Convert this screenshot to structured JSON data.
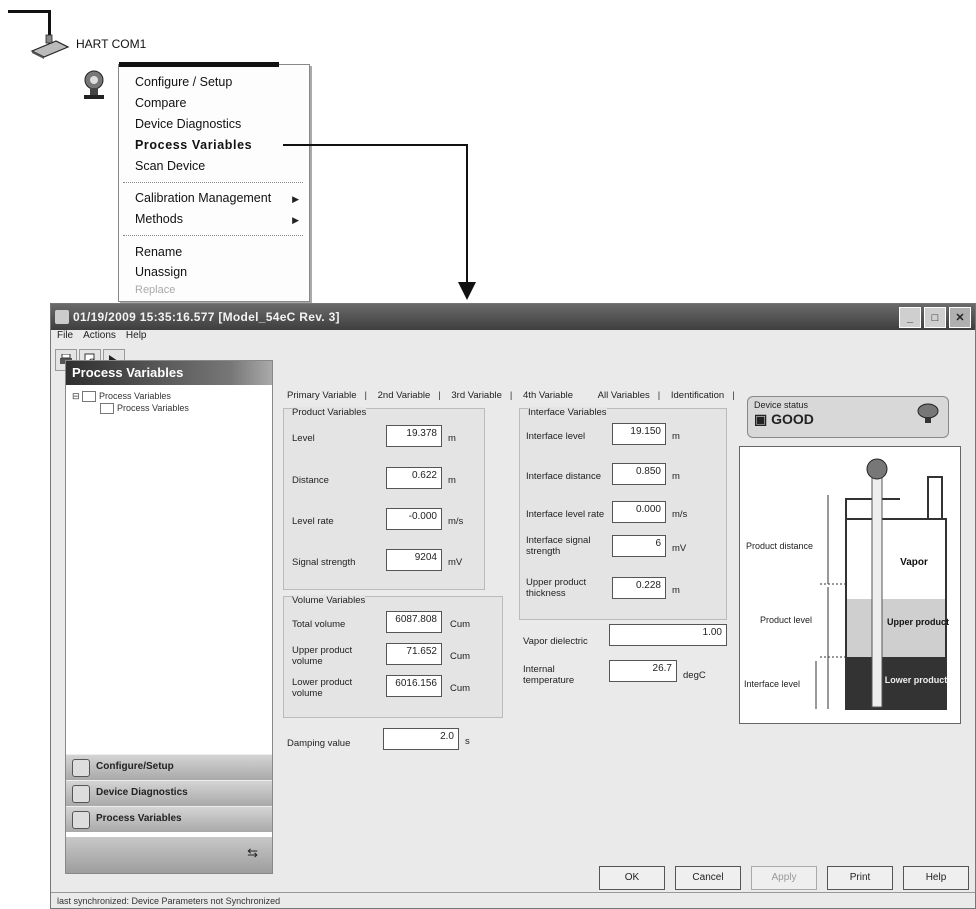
{
  "tree": {
    "hart_label": "HART COM1"
  },
  "context_menu": {
    "items": [
      {
        "label": "Configure / Setup"
      },
      {
        "label": "Compare"
      },
      {
        "label": "Device Diagnostics"
      },
      {
        "label": "Process Variables"
      },
      {
        "label": "Scan Device"
      },
      {
        "label": "Calibration Management"
      },
      {
        "label": "Methods"
      },
      {
        "label": "Rename"
      },
      {
        "label": "Unassign"
      },
      {
        "label": "Replace"
      }
    ],
    "submenu_glyph": "▶"
  },
  "window": {
    "title": "01/19/2009 15:35:16.577 [Model_54eC Rev. 3]",
    "controls": {
      "minimize": "_",
      "maximize": "□",
      "close": "✕"
    },
    "menu": {
      "file": "File",
      "actions": "Actions",
      "help": "Help"
    },
    "toolbar_icons": [
      "print-icon",
      "print-preview-icon",
      "help-icon"
    ]
  },
  "left_pane": {
    "header": "Process Variables",
    "tree_root": "Process Variables",
    "tree_child": "Process Variables",
    "nav": {
      "configure": "Configure/Setup",
      "diagnostics": "Device Diagnostics",
      "process": "Process Variables"
    }
  },
  "tabs": [
    "Primary Variable",
    "2nd Variable",
    "3rd Variable",
    "4th Variable",
    "All Variables",
    "Identification"
  ],
  "product": {
    "title": "Product Variables",
    "level": {
      "label": "Level",
      "value": "19.378",
      "unit": "m"
    },
    "distance": {
      "label": "Distance",
      "value": "0.622",
      "unit": "m"
    },
    "level_rate": {
      "label": "Level rate",
      "value": "-0.000",
      "unit": "m/s"
    },
    "signal": {
      "label": "Signal strength",
      "value": "9204",
      "unit": "mV"
    }
  },
  "volume": {
    "title": "Volume Variables",
    "total": {
      "label": "Total volume",
      "value": "6087.808",
      "unit": "Cum"
    },
    "upper": {
      "label": "Upper product volume",
      "value": "71.652",
      "unit": "Cum"
    },
    "lower": {
      "label": "Lower product volume",
      "value": "6016.156",
      "unit": "Cum"
    }
  },
  "damping": {
    "label": "Damping value",
    "value": "2.0",
    "unit": "s"
  },
  "interface": {
    "title": "Interface Variables",
    "level": {
      "label": "Interface level",
      "value": "19.150",
      "unit": "m"
    },
    "distance": {
      "label": "Interface distance",
      "value": "0.850",
      "unit": "m"
    },
    "rate": {
      "label": "Interface level rate",
      "value": "0.000",
      "unit": "m/s"
    },
    "signal": {
      "label": "Interface signal strength",
      "value": "6",
      "unit": "mV"
    },
    "thickness": {
      "label": "Upper product thickness",
      "value": "0.228",
      "unit": "m"
    }
  },
  "vapor_dielectric": {
    "label": "Vapor dielectric",
    "value": "1.00"
  },
  "internal_temp": {
    "label": "Internal temperature",
    "value": "26.7",
    "unit": "degC"
  },
  "device_status": {
    "label": "Device status",
    "value": "GOOD"
  },
  "tank": {
    "product_distance": "Product distance",
    "product_level": "Product level",
    "interface_level": "Interface level",
    "vapor": "Vapor",
    "upper_product": "Upper product",
    "lower_product": "Lower product"
  },
  "buttons": {
    "ok": "OK",
    "cancel": "Cancel",
    "apply": "Apply",
    "print": "Print",
    "help": "Help"
  },
  "statusbar": "last synchronized: Device Parameters not Synchronized"
}
